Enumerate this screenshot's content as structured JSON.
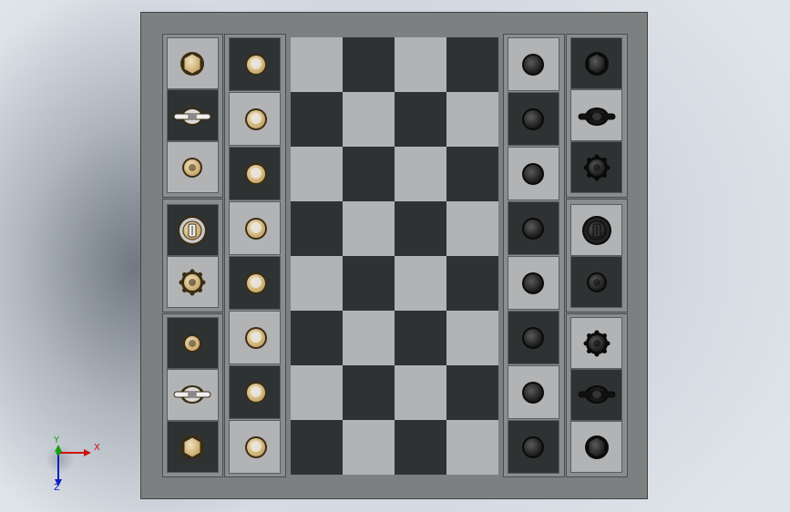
{
  "viewport": {
    "background": "gradient-gray-blue"
  },
  "board": {
    "rows": 8,
    "cols": 4,
    "light_color": "#b1b3b4",
    "dark_color": "#2f3233",
    "base_color": "#7d8080"
  },
  "white_pawns": {
    "count": 8,
    "piece": "pawn",
    "color": "gold"
  },
  "black_pawns": {
    "count": 8,
    "piece": "pawn",
    "color": "black"
  },
  "white_pieces": [
    "rook",
    "bishop",
    "king",
    "queen",
    "knight-top",
    "king-small",
    "bishop",
    "rook"
  ],
  "black_pieces": [
    "rook",
    "bishop",
    "knight",
    "queen",
    "king",
    "knight",
    "bishop",
    "rook"
  ],
  "triad": {
    "x_label": "X",
    "y_label": "Y",
    "z_label": "Z",
    "x_color": "#d01010",
    "y_color": "#10a010",
    "z_color": "#1020c0"
  }
}
